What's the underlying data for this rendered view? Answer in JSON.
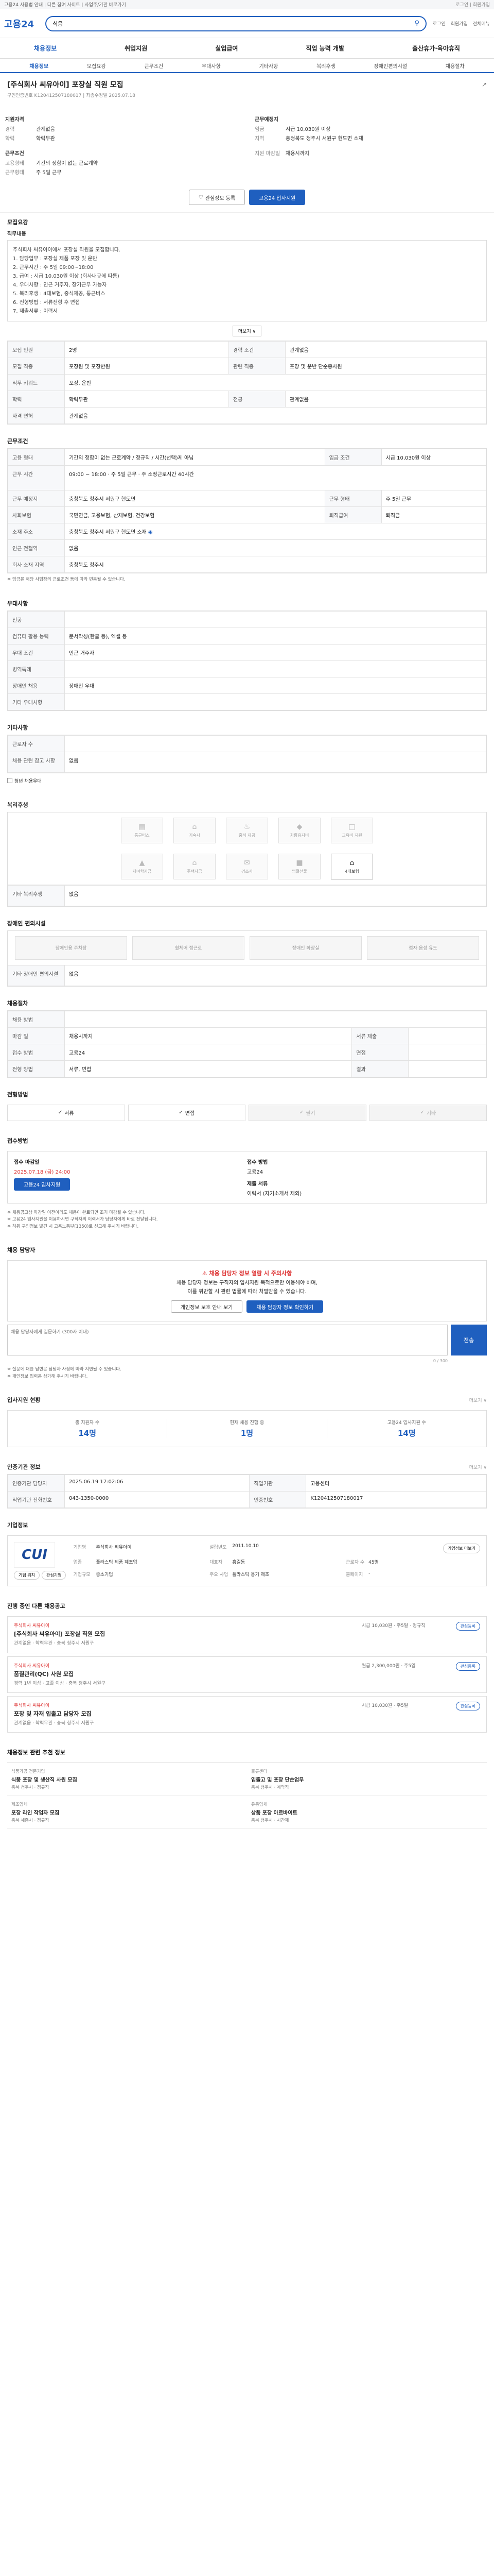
{
  "topbar": {
    "left": "고용24 사용법 안내 | 다른 참여 사이트 | 사업주/기관 바로가기",
    "right": "로그인 | 회원가입"
  },
  "header": {
    "logo": "고용24",
    "search_value": "식음",
    "links": [
      "로그인",
      "회원가입",
      "전체메뉴"
    ]
  },
  "gnb": [
    "채용정보",
    "취업지원",
    "실업급여",
    "직업 능력 개발",
    "출산휴가·육아휴직"
  ],
  "subnav": [
    "채용정보",
    "모집요강",
    "근무조건",
    "우대사항",
    "기타사항",
    "복리후생",
    "장애인편의시설",
    "채용절차",
    "전형방법",
    "접수방법",
    "제출서류"
  ],
  "job": {
    "title": "[주식회사 씨유아이] 포장실 직원 모집",
    "sub": "구인인증번호 K120412507180017 | 최종수정일 2025.07.18",
    "wage_h": "지원자격",
    "summary_left": [
      {
        "k": "경력",
        "v": "관계없음"
      },
      {
        "k": "학력",
        "v": "학력무관"
      }
    ],
    "cond_h": "근무조건",
    "summary_left2": [
      {
        "k": "고용형태",
        "v": "기간의 정함이 없는 근로계약"
      },
      {
        "k": "근무형태",
        "v": "주 5일 근무"
      }
    ],
    "work_h": "근무예정지",
    "summary_right": [
      {
        "k": "임금",
        "v": "시급 10,030원 이상"
      },
      {
        "k": "지역",
        "v": "충청북도 청주시 서원구 현도면 소재"
      }
    ],
    "summary_right2": [
      {
        "k": "지원 마감일",
        "v": "채용시까지"
      }
    ],
    "btn_scrap": "관심정보 등록",
    "btn_apply": "고용24 입사지원"
  },
  "recruit": {
    "h": "모집요강",
    "desc_h": "직무내용",
    "desc": [
      "주식회사 씨유아이에서 포장실 직원을 모집합니다.",
      "1. 담당업무 : 포장실 제품 포장 및 운반",
      "2. 근무시간 : 주 5일 09:00~18:00",
      "3. 급여 : 시급 10,030원 이상 (회사내규에 따름)",
      "4. 우대사항 : 인근 거주자, 장기근무 가능자",
      "5. 복리후생 : 4대보험, 중식제공, 통근버스",
      "6. 전형방법 : 서류전형 후 면접",
      "7. 제출서류 : 이력서"
    ],
    "more": "더보기 ∨",
    "rows": [
      [
        {
          "k": "모집 인원",
          "v": "2명"
        },
        {
          "k": "경력 조건",
          "v": "관계없음"
        }
      ],
      [
        {
          "k": "모집 직종",
          "v": "포장원 및 포장반원"
        },
        {
          "k": "관련 직종",
          "v": "포장 및 운반 단순종사원"
        }
      ],
      [
        {
          "k": "직무 키워드",
          "v": "포장, 운반"
        }
      ],
      [
        {
          "k": "학력",
          "v": "학력무관"
        },
        {
          "k": "전공",
          "v": "관계없음"
        }
      ],
      [
        {
          "k": "자격 면허",
          "v": "관계없음"
        }
      ]
    ]
  },
  "conditions": {
    "h": "근무조건",
    "rows": [
      [
        {
          "k": "고용 형태",
          "v": "기간의 정함이 없는 근로계약 / 정규직 / 시간(선택)제 아님"
        },
        {
          "k": "임금 조건",
          "v": "시급 10,030원 이상"
        }
      ],
      [
        {
          "k": "근무 시간",
          "v": "09:00 ~ 18:00 · 주 5일 근무 · 주 소정근로시간 40시간"
        }
      ],
      [
        {
          "k": "근무 예정지",
          "v": "충청북도 청주시 서원구 현도면"
        },
        {
          "k": "근무 형태",
          "v": "주 5일 근무"
        }
      ],
      [
        {
          "k": "사회보험",
          "v": "국민연금, 고용보험, 산재보험, 건강보험"
        },
        {
          "k": "퇴직급여",
          "v": "퇴직금"
        }
      ],
      [
        {
          "k": "소재 주소",
          "v": "충청북도 청주시 서원구 현도면 소재"
        }
      ],
      [
        {
          "k": "인근 전철역",
          "v": "없음"
        }
      ],
      [
        {
          "k": "회사 소재 지역",
          "v": "충청북도 청주시"
        }
      ]
    ],
    "note": "※ 임금은 해당 사업장의 근로조건 등에 따라 변동될 수 있습니다."
  },
  "prefer": {
    "h": "우대사항",
    "rows": [
      [
        {
          "k": "전공",
          "v": ""
        }
      ],
      [
        {
          "k": "컴퓨터 활용 능력",
          "v": "문서작성(한글 등), 엑셀 등"
        }
      ],
      [
        {
          "k": "우대 조건",
          "v": "인근 거주자"
        }
      ],
      [
        {
          "k": "병역특례",
          "v": ""
        }
      ],
      [
        {
          "k": "장애인 채용",
          "v": "장애인 우대"
        }
      ],
      [
        {
          "k": "기타 우대사항",
          "v": ""
        }
      ]
    ]
  },
  "etc": {
    "h": "기타사항",
    "rows": [
      [
        {
          "k": "근로자 수",
          "v": ""
        }
      ],
      [
        {
          "k": "채용 관련 참고 사항",
          "v": "없음"
        }
      ]
    ],
    "check": "청년 채용우대"
  },
  "benefit": {
    "h": "복리후생",
    "icons": [
      {
        "l": "통근버스",
        "on": false
      },
      {
        "l": "기숙사",
        "on": false
      },
      {
        "l": "중식 제공",
        "on": false
      },
      {
        "l": "차량유지비",
        "on": false
      },
      {
        "l": "교육비 지원",
        "on": false
      },
      {
        "l": "자녀학자금",
        "on": false
      },
      {
        "l": "주택자금",
        "on": false
      },
      {
        "l": "경조사",
        "on": false
      },
      {
        "l": "명절선물",
        "on": false
      },
      {
        "l": "4대보험",
        "on": true
      }
    ],
    "etc_h": "기타 복리후생",
    "etc_v": "없음"
  },
  "facility": {
    "h": "장애인 편의시설",
    "cards": [
      "장애인용 주차장",
      "휠체어 접근로",
      "장애인 화장실",
      "점자·음성 유도"
    ],
    "etc_h": "기타 장애인 편의시설",
    "etc_v": "없음"
  },
  "process": {
    "h": "채용절차",
    "rows": [
      [
        {
          "k": "채용 방법",
          "v": ""
        }
      ],
      [
        {
          "k": "마감 일",
          "v": "채용시까지"
        },
        {
          "k": "서류 제출",
          "v": ""
        }
      ],
      [
        {
          "k": "접수 방법",
          "v": "고용24"
        },
        {
          "k": "면접",
          "v": ""
        }
      ],
      [
        {
          "k": "전형 방법",
          "v": "서류, 면접"
        },
        {
          "k": "결과",
          "v": ""
        }
      ]
    ]
  },
  "screening": {
    "h": "전형방법",
    "steps": [
      {
        "l": "서류",
        "on": true
      },
      {
        "l": "면접",
        "on": true
      },
      {
        "l": "필기",
        "on": false
      },
      {
        "l": "기타",
        "on": false
      }
    ]
  },
  "apply": {
    "h": "접수방법",
    "c1_h": "접수 마감일",
    "c1_v": "2025.07.18 (금) 24:00",
    "c1_btn": "고용24 입사지원",
    "c2_h": "접수 방법",
    "c2_v": "고용24",
    "c3_h": "제출 서류",
    "c3_v": "이력서 (자기소개서 제외)",
    "notes": [
      "※ 채용공고상 마감일 이전이라도 채용이 완료되면 조기 마감될 수 있습니다.",
      "※ 고용24 입사지원을 이용하시면 구직자의 이력서가 담당자에게 바로 전달됩니다.",
      "※ 허위 구인정보 발견 시 고용노동부(1350)로 신고해 주시기 바랍니다."
    ]
  },
  "contact": {
    "h": "채용 담당자",
    "warn": "채용 담당자 정보 열람 시 주의사항",
    "lines": [
      "채용 담당자 정보는 구직자의 입사지원 목적으로만 이용해야 하며,",
      "이를 위반할 시 관련 법률에 따라 처벌받을 수 있습니다."
    ],
    "btn1": "개인정보 보호 안내 보기",
    "btn2": "채용 담당자 정보 확인하기",
    "qa_placeholder": "채용 담당자에게 질문하기 (300자 이내)",
    "qa_btn": "전송",
    "qa_count": "0 / 300",
    "notes": [
      "※ 질문에 대한 답변은 담당자 사정에 따라 지연될 수 있습니다.",
      "※ 개인정보 입력은 삼가해 주시기 바랍니다."
    ]
  },
  "stats": {
    "h": "입사지원 현황",
    "more": "더보기 ∨",
    "items": [
      {
        "k": "총 지원자 수",
        "v": "14명"
      },
      {
        "k": "현재 채용 진행 중",
        "v": "1명"
      },
      {
        "k": "고용24 입사지원 수",
        "v": "14명"
      }
    ]
  },
  "info": {
    "h": "인증기관 정보",
    "rows": [
      [
        {
          "k": "인증기관 담당자",
          "v": "2025.06.19 17:02:06"
        },
        {
          "k": "직업기관",
          "v": "고용센터"
        }
      ],
      [
        {
          "k": "직업기관 전화번호",
          "v": "043-1350-0000"
        },
        {
          "k": "인증번호",
          "v": "K120412507180017"
        }
      ]
    ],
    "more": "더보기 ∨"
  },
  "company": {
    "h": "기업정보",
    "logo": "CUI",
    "btn": "기업정보 더보기",
    "fields": [
      {
        "k": "기업명",
        "v": "주식회사 씨유아이"
      },
      {
        "k": "설립년도",
        "v": "2011.10.10"
      },
      {
        "k": "업종",
        "v": "플라스틱 제품 제조업"
      },
      {
        "k": "대표자",
        "v": "홍길동"
      },
      {
        "k": "근로자 수",
        "v": "45명"
      },
      {
        "k": "기업규모",
        "v": "중소기업"
      },
      {
        "k": "주요 사업",
        "v": "플라스틱 용기 제조"
      },
      {
        "k": "홈페이지",
        "v": "-"
      },
      {
        "k": "자본금",
        "v": "-"
      }
    ],
    "links": [
      "기업 위치",
      "관심기업"
    ]
  },
  "listings": {
    "h": "진행 중인 다른 채용공고",
    "items": [
      {
        "co": "주식회사 씨유아이",
        "title": "[주식회사 씨유아이] 포장실 직원 모집",
        "meta": "관계없음 · 학력무관 · 충북 청주시 서원구",
        "side": "시급 10,030원 · 주5일 · 정규직",
        "btn": "관심등록"
      },
      {
        "co": "주식회사 씨유아이",
        "title": "품질관리(QC) 사원 모집",
        "meta": "경력 1년 이상 · 고졸 이상 · 충북 청주시 서원구",
        "side": "월급 2,300,000원 · 주5일",
        "btn": "관심등록"
      },
      {
        "co": "주식회사 씨유아이",
        "title": "포장 및 자재 입출고 담당자 모집",
        "meta": "관계없음 · 학력무관 · 충북 청주시 서원구",
        "side": "시급 10,030원 · 주5일",
        "btn": "관심등록"
      }
    ]
  },
  "related": {
    "h": "채용정보 관련 추천 정보",
    "items": [
      {
        "co": "식품가공 전문기업",
        "title": "식품 포장 및 생산직 사원 모집",
        "m": "충북 청주시 · 정규직"
      },
      {
        "co": "물류센터",
        "title": "입출고 및 포장 단순업무",
        "m": "충북 청주시 · 계약직"
      },
      {
        "co": "제조업체",
        "title": "포장 라인 작업자 모집",
        "m": "충북 세종시 · 정규직"
      },
      {
        "co": "유통업체",
        "title": "상품 포장 아르바이트",
        "m": "충북 청주시 · 시간제"
      }
    ]
  }
}
